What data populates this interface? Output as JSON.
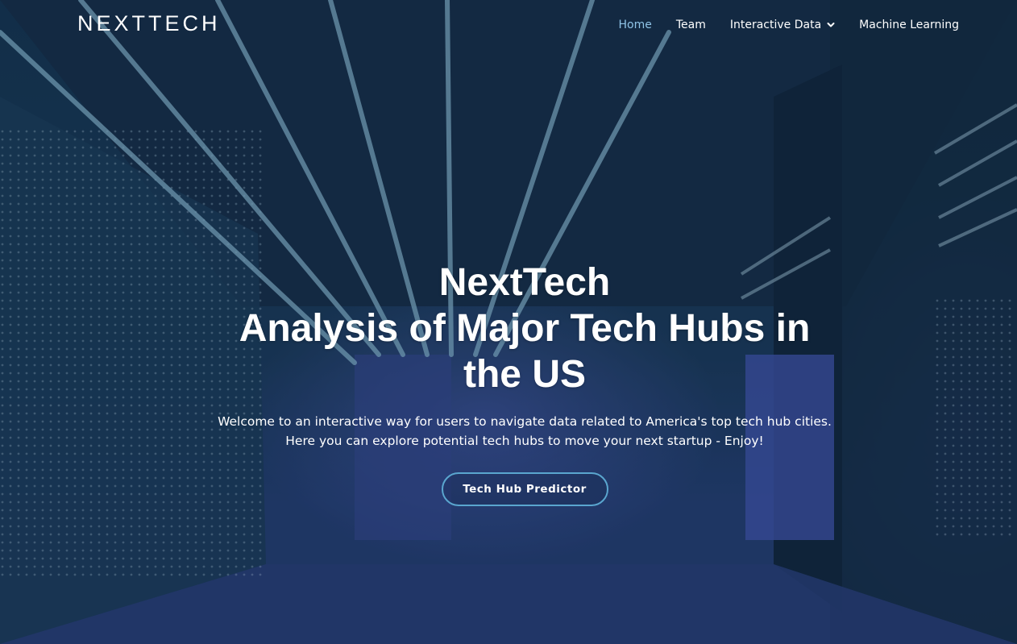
{
  "brand": {
    "logo_text": "NEXTTECH"
  },
  "nav": {
    "items": [
      {
        "label": "Home",
        "active": true
      },
      {
        "label": "Team",
        "active": false
      },
      {
        "label": "Interactive Data",
        "active": false,
        "dropdown": true
      },
      {
        "label": "Machine Learning",
        "active": false
      }
    ]
  },
  "hero": {
    "title_lines": [
      "NextTech",
      "Analysis of Major Tech Hubs in",
      "the US"
    ],
    "subtitle_lines": [
      "Welcome to an interactive way for users to navigate data related to America's top tech hub cities.",
      "Here you can explore potential tech hubs to move your next startup - Enjoy!"
    ],
    "cta_label": "Tech Hub Predictor"
  },
  "colors": {
    "accent": "#8fc3e6",
    "button_border": "#5aa6cf",
    "overlay": "#0c243c"
  },
  "icons": {
    "dropdown": "chevron-down-icon"
  }
}
